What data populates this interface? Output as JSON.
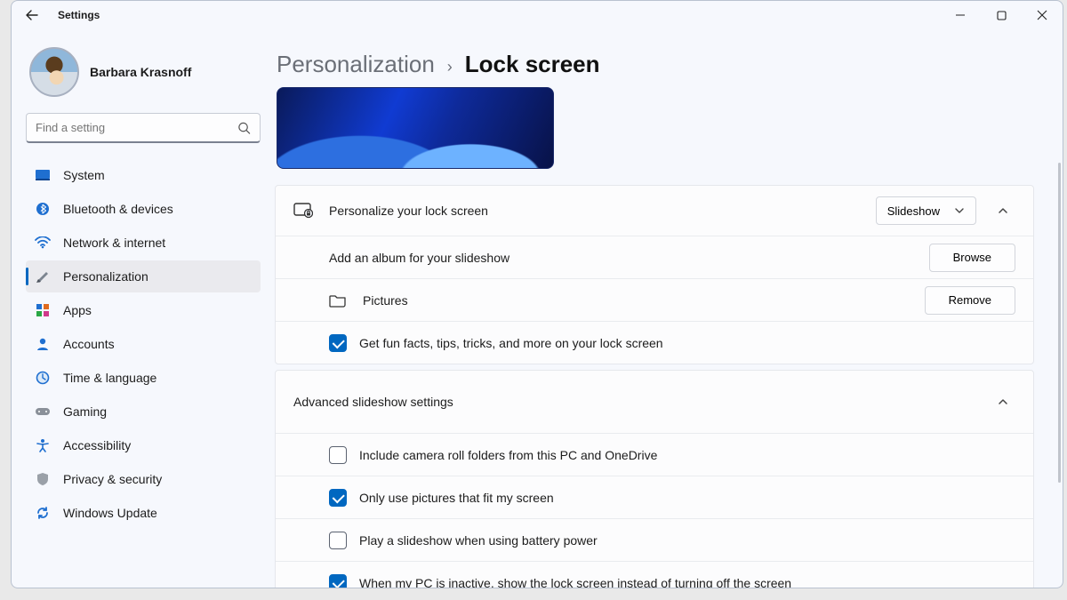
{
  "window": {
    "title": "Settings"
  },
  "user": {
    "name": "Barbara Krasnoff"
  },
  "search": {
    "placeholder": "Find a setting"
  },
  "nav": {
    "items": [
      {
        "label": "System"
      },
      {
        "label": "Bluetooth & devices"
      },
      {
        "label": "Network & internet"
      },
      {
        "label": "Personalization"
      },
      {
        "label": "Apps"
      },
      {
        "label": "Accounts"
      },
      {
        "label": "Time & language"
      },
      {
        "label": "Gaming"
      },
      {
        "label": "Accessibility"
      },
      {
        "label": "Privacy & security"
      },
      {
        "label": "Windows Update"
      }
    ]
  },
  "breadcrumb": {
    "parent": "Personalization",
    "sep": "›",
    "current": "Lock screen"
  },
  "lockscreen": {
    "personalize_label": "Personalize your lock screen",
    "mode_selected": "Slideshow",
    "add_album_label": "Add an album for your slideshow",
    "browse_label": "Browse",
    "album_name": "Pictures",
    "remove_label": "Remove",
    "funfacts_label": "Get fun facts, tips, tricks, and more on your lock screen"
  },
  "advanced": {
    "heading": "Advanced slideshow settings",
    "camera_roll": "Include camera roll folders from this PC and OneDrive",
    "fit_screen": "Only use pictures that fit my screen",
    "battery": "Play a slideshow when using battery power",
    "inactive": "When my PC is inactive, show the lock screen instead of turning off the screen"
  }
}
